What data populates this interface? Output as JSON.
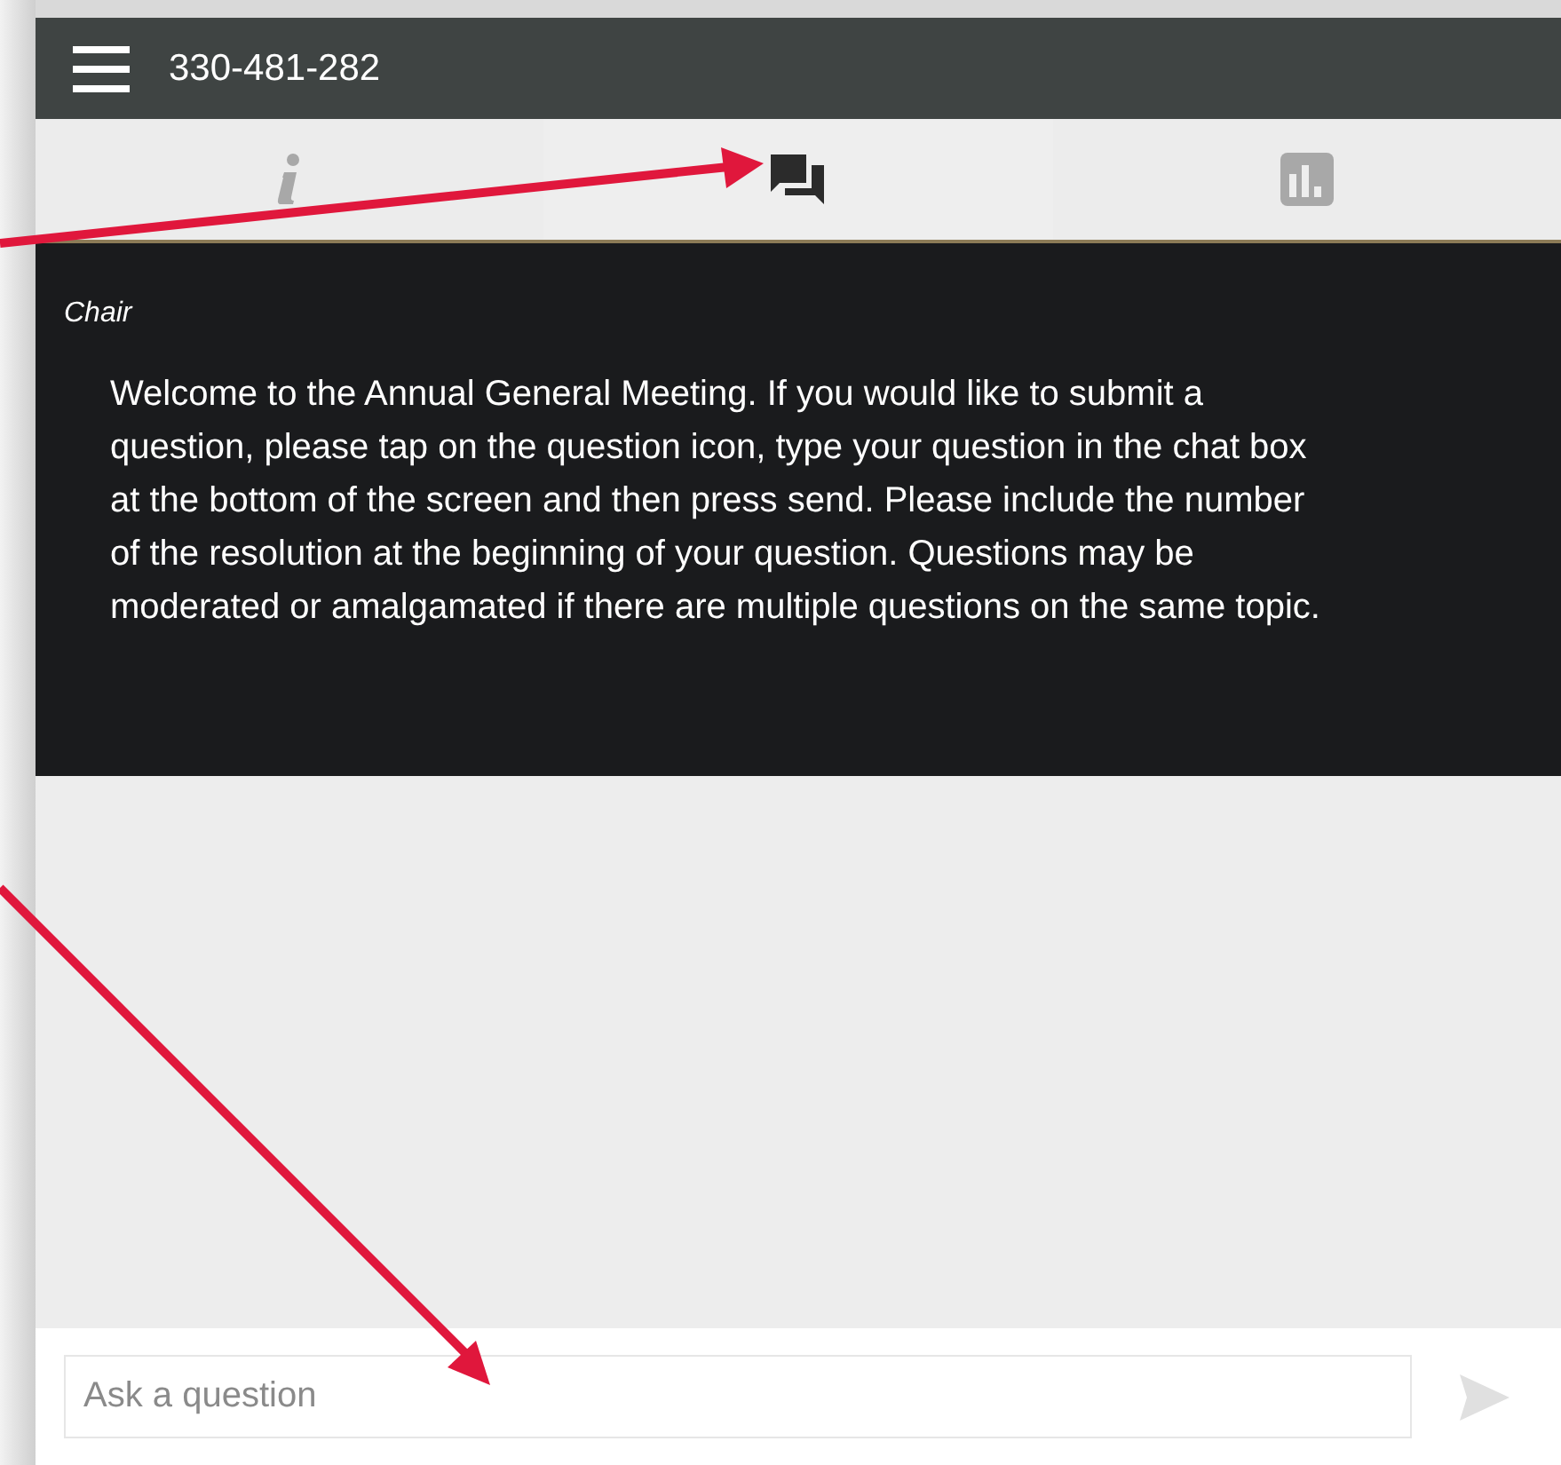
{
  "header": {
    "title": "330-481-282"
  },
  "tabs": [
    {
      "kind": "info",
      "selected": false
    },
    {
      "kind": "chat",
      "selected": true
    },
    {
      "kind": "poll",
      "selected": false
    }
  ],
  "messages": [
    {
      "sender": "Chair",
      "text": "Welcome to the Annual General Meeting. If you would like to submit a question, please tap on the question icon, type your question in the chat box at the bottom of the screen and then press send. Please include the number of the resolution at the beginning of your question. Questions may be moderated or amalgamated if there are multiple questions on the same topic."
    }
  ],
  "composer": {
    "placeholder": "Ask a question",
    "send_disabled": true
  }
}
